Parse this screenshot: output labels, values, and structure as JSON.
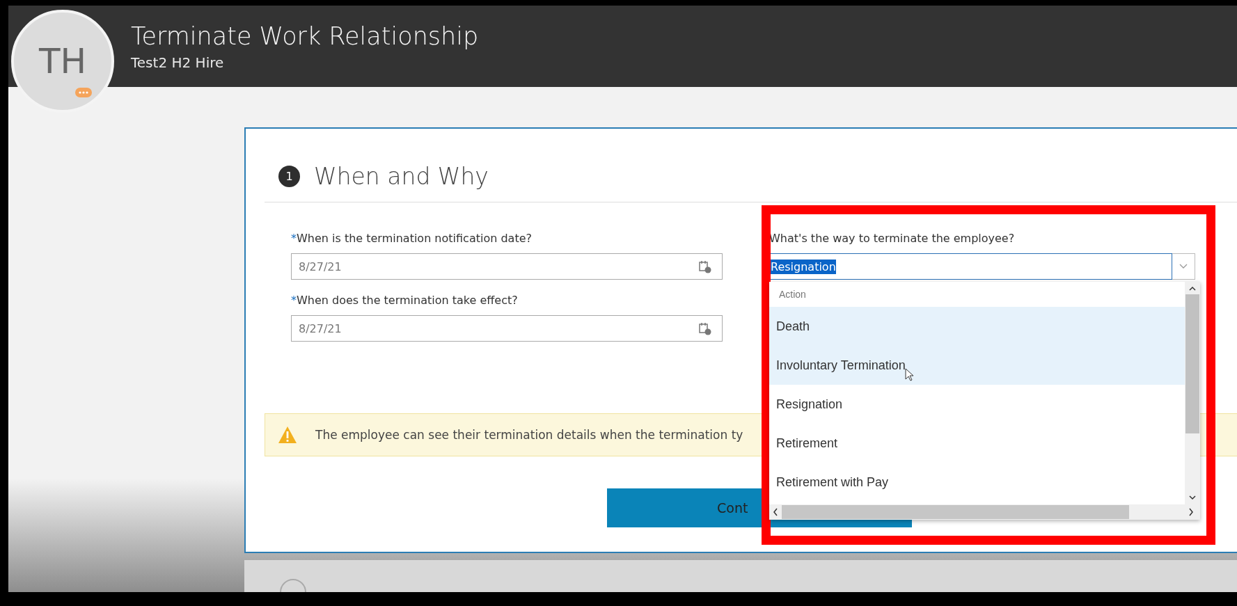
{
  "header": {
    "avatar_initials": "TH",
    "title": "Terminate Work Relationship",
    "subtitle": "Test2 H2 Hire"
  },
  "step": {
    "number": "1",
    "title": "When and Why"
  },
  "date_fields": [
    {
      "required_mark": "*",
      "label": "When is the termination notification date?",
      "value": "8/27/21"
    },
    {
      "required_mark": "*",
      "label": "When does the termination take effect?",
      "value": "8/27/21"
    }
  ],
  "termination_way": {
    "label": "What's the way to terminate the employee?",
    "value": "Resignation",
    "value_selected": true,
    "expanded": true,
    "options_header": "Action",
    "options": [
      {
        "label": "Death",
        "highlighted": true
      },
      {
        "label": "Involuntary Termination",
        "highlighted": true
      },
      {
        "label": "Resignation",
        "highlighted": false
      },
      {
        "label": "Retirement",
        "highlighted": false
      },
      {
        "label": "Retirement with Pay",
        "highlighted": false
      }
    ]
  },
  "warning": {
    "text": "The employee can see their termination details when the termination ty"
  },
  "continue_button": {
    "label": "Cont"
  }
}
